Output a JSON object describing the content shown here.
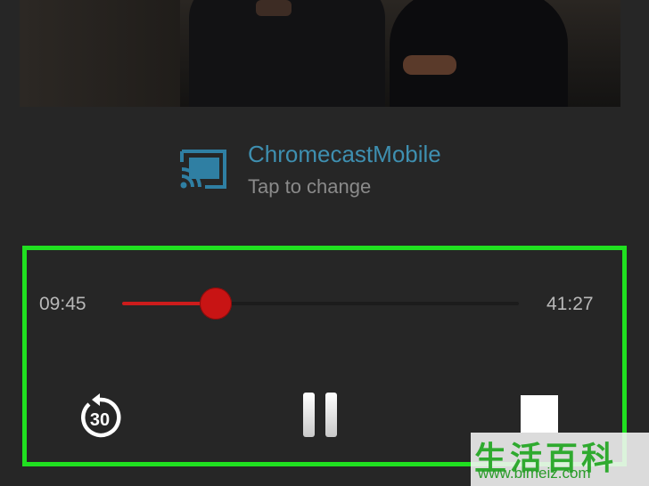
{
  "cast": {
    "device_name": "ChromecastMobile",
    "subtitle": "Tap to change",
    "icon": "cast-icon",
    "accent_color": "#3e8fb0"
  },
  "playback": {
    "elapsed": "09:45",
    "total": "41:27",
    "progress_fraction": 0.235,
    "accent_color": "#cc1c1c"
  },
  "controls": {
    "replay_icon": "replay-30-icon",
    "replay_label": "30",
    "pause_icon": "pause-icon",
    "stop_icon": "stop-icon"
  },
  "watermark": {
    "chars": "生活百科",
    "url": "www.bimeiz.com"
  },
  "colors": {
    "highlight": "#20e020",
    "background": "#262626"
  }
}
